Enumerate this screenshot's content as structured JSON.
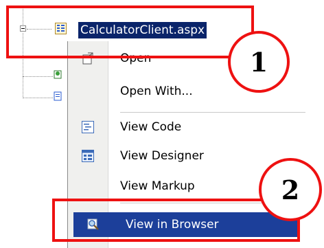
{
  "tree": {
    "selected_item": "CalculatorClient.aspx",
    "icons": [
      "aspx-file-icon",
      "service-reference-icon",
      "config-file-icon"
    ]
  },
  "context_menu": {
    "items": [
      {
        "label": "Open",
        "icon": "open-icon"
      },
      {
        "label": "Open With...",
        "icon": ""
      },
      {
        "label": "View Code",
        "icon": "view-code-icon"
      },
      {
        "label": "View Designer",
        "icon": "view-designer-icon"
      },
      {
        "label": "View Markup",
        "icon": ""
      },
      {
        "label": "View in Browser",
        "icon": "view-in-browser-icon",
        "highlighted": true
      }
    ]
  },
  "annotations": [
    {
      "number": "1",
      "color": "#ee1111"
    },
    {
      "number": "2",
      "color": "#ee1111"
    }
  ],
  "colors": {
    "selection": "#0a246a",
    "menu_highlight": "#1c3f9a",
    "annotation": "#ee1111"
  }
}
